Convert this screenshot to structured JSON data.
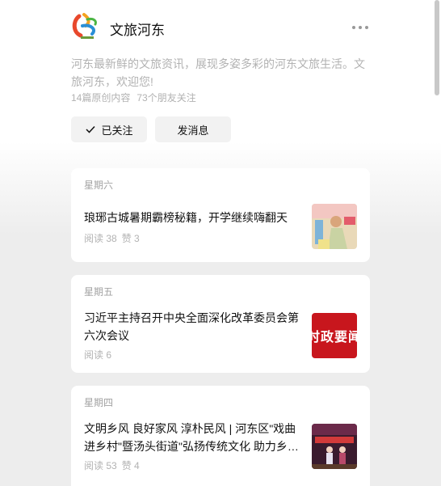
{
  "account": {
    "name": "文旅河东",
    "description": "河东最新鲜的文旅资讯，展现多姿多彩的河东文旅生活。文旅河东，欢迎您!",
    "original_count": "14篇原创内容",
    "followers": "73个朋友关注",
    "logo_icon": "wenlv-hedong-logo-icon"
  },
  "actions": {
    "follow_label": "已关注",
    "message_label": "发消息"
  },
  "articles": [
    {
      "day": "星期六",
      "title": "琅琊古城暑期霸榜秘籍，开学继续嗨翻天",
      "read": "阅读 38",
      "like": "赞 3",
      "thumb": "festival-photo"
    },
    {
      "day": "星期五",
      "title": "习近平主持召开中央全面深化改革委员会第六次会议",
      "read": "阅读 6",
      "like": "",
      "thumb_text": "时政要闻"
    },
    {
      "day": "星期四",
      "title": "文明乡风 良好家风 淳朴民风 | 河东区\"戏曲进乡村\"暨汤头街道\"弘扬传统文化 助力乡…",
      "read": "阅读 53",
      "like": "赞 4",
      "thumb": "stage-performance-photo"
    }
  ],
  "colors": {
    "thumb_red": "#c8161d",
    "muted_text": "#b2b2b2"
  }
}
